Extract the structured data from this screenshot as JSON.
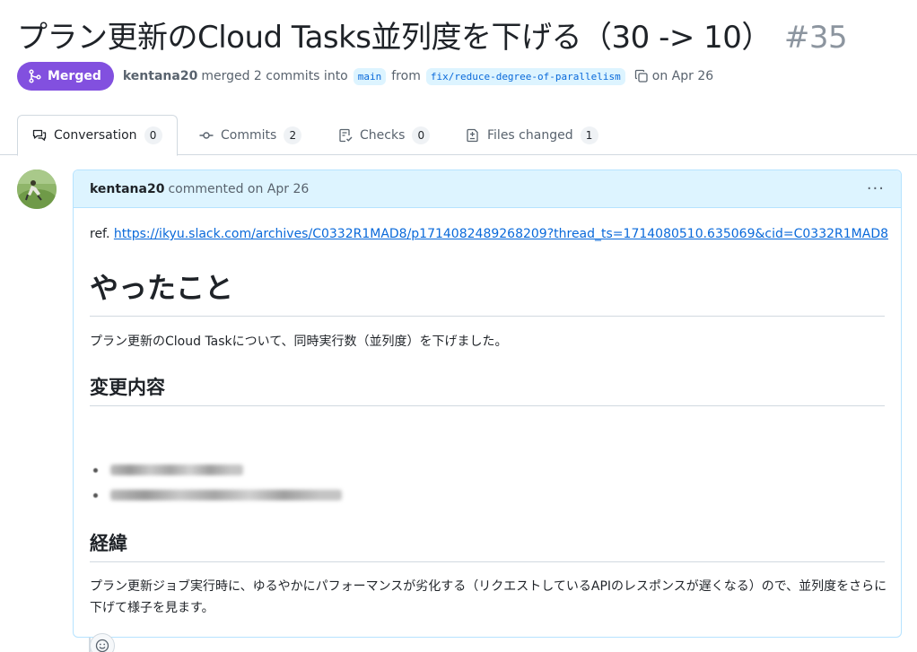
{
  "pr": {
    "title": "プラン更新のCloud Tasks並列度を下げる（30 -> 10）",
    "number": "#35",
    "status": "Merged",
    "author": "kentana20",
    "merge_text": "merged 2 commits into",
    "base_branch": "main",
    "from_text": "from",
    "head_branch": "fix/reduce-degree-of-parallelism",
    "date_text": "on Apr 26"
  },
  "tabs": [
    {
      "label": "Conversation",
      "count": "0",
      "icon": "comment-discussion-icon"
    },
    {
      "label": "Commits",
      "count": "2",
      "icon": "git-commit-icon"
    },
    {
      "label": "Checks",
      "count": "0",
      "icon": "checklist-icon"
    },
    {
      "label": "Files changed",
      "count": "1",
      "icon": "file-diff-icon"
    }
  ],
  "comment": {
    "author": "kentana20",
    "meta": "commented on Apr 26",
    "menu": "···",
    "ref_prefix": "ref.",
    "ref_link": "https://ikyu.slack.com/archives/C0332R1MAD8/p1714082489268209?thread_ts=1714080510.635069&cid=C0332R1MAD8",
    "heading1": "やったこと",
    "paragraph1": "プラン更新のCloud Taskについて、同時実行数（並列度）を下げました。",
    "heading2": "変更内容",
    "heading3": "経緯",
    "paragraph2": "プラン更新ジョブ実行時に、ゆるやかにパフォーマンスが劣化する（リクエストしているAPIのレスポンスが遅くなる）ので、並列度をさらに下げて様子を見ます。"
  },
  "colors": {
    "merged": "#8250df",
    "link": "#0969da",
    "header_bg": "#ddf4ff"
  }
}
